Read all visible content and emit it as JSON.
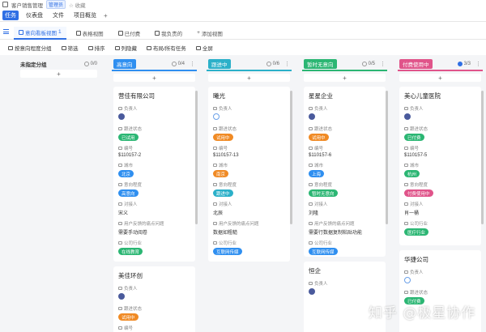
{
  "topbar": {
    "breadcrumb": "客户销售管理",
    "badge": "管理员",
    "fav": "☆ 收藏"
  },
  "nav": {
    "tabs": [
      "任务",
      "仪表盘",
      "文件",
      "项目概览"
    ],
    "plus": "+"
  },
  "views": {
    "tabs": [
      {
        "label": "意向看板视图",
        "count": "1",
        "active": true
      },
      {
        "label": "表格视图"
      },
      {
        "label": "已付费"
      },
      {
        "label": "我负责的"
      },
      {
        "label": "添加视图"
      }
    ]
  },
  "toolbar": {
    "items": [
      "按意向程度分组",
      "筛选",
      "排序",
      "列隐藏",
      "布局/所有任务",
      "全屏"
    ]
  },
  "colors": {
    "accent": "#2f6fe4",
    "tag_green": "#2bb673",
    "tag_orange": "#f08a24",
    "tag_blue": "#2f8ff0",
    "tag_purple": "#a356d6",
    "tag_pink": "#e0548a"
  },
  "columns": [
    {
      "name": "未指定分组",
      "count": "0/0"
    },
    {
      "name": "高意向",
      "count": "0/4"
    },
    {
      "name": "跟进中",
      "count": "0/6"
    },
    {
      "name": "暂时无意向",
      "count": "0/5"
    },
    {
      "name": "付费使用中",
      "count": "3/3"
    }
  ],
  "labels": {
    "owner": "负责人",
    "status": "跟进状态",
    "no": "编号",
    "city": "城市",
    "intent": "意向程度",
    "contact": "对接人",
    "pain": "用户反馈的痛点问题",
    "industry": "公司行业"
  },
  "cards": {
    "c1": {
      "title": "营佳有限公司",
      "status": "已试用",
      "no": "$110157-2",
      "city": "北京",
      "intent": "高意向",
      "contact": "宋义",
      "pain": "需要手动阅卷",
      "industry": "在线教育"
    },
    "c1b": {
      "title": "美佳环创",
      "status": "试用中"
    },
    "c2": {
      "title": "曦光",
      "status": "试用中",
      "no": "$110157-13",
      "city": "南京",
      "intent": "跟进中",
      "contact": "北辰",
      "pain": "数据如粗糙",
      "industry": "互联网传媒"
    },
    "c3": {
      "title": "星星企业",
      "status": "试用中",
      "no": "$110157-6",
      "city": "上海",
      "intent": "暂时无意向",
      "contact": "刘隆",
      "pain": "需要行数据复制粘贴功能",
      "industry": "互联网传媒"
    },
    "c3b": {
      "title": "恒企"
    },
    "c4": {
      "title": "美心儿童医院",
      "status": "已付费",
      "no": "$110157-5",
      "city": "杭州",
      "intent": "付费使用中",
      "contact": "肖一桶",
      "industry": "医疗行业"
    },
    "c4b": {
      "title": "华捷公司",
      "status": "已付费"
    }
  },
  "watermark": "知乎 @极星协作"
}
